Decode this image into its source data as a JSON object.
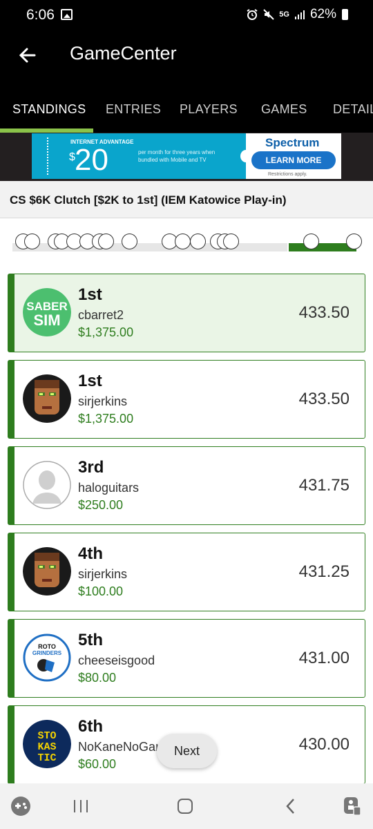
{
  "status": {
    "time": "6:06",
    "battery": "62%",
    "network": "5G"
  },
  "app": {
    "title": "GameCenter"
  },
  "tabs": [
    {
      "label": "STANDINGS",
      "active": true
    },
    {
      "label": "ENTRIES",
      "active": false
    },
    {
      "label": "PLAYERS",
      "active": false
    },
    {
      "label": "GAMES",
      "active": false
    },
    {
      "label": "DETAIL",
      "active": false
    }
  ],
  "ad": {
    "tagline": "INTERNET ADVANTAGE",
    "price": "20",
    "description": "per month for three years when bundled with Mobile and TV",
    "brand": "Spectrum",
    "cta": "LEARN MORE",
    "fine_print": "Restrictions apply."
  },
  "contest": {
    "title": "CS $6K Clutch [$2K to 1st] (IEM Katowice Play-in)"
  },
  "standings": [
    {
      "rank": "1st",
      "username": "cbarret2",
      "prize": "$1,375.00",
      "score": "433.50",
      "avatar": "sabersim-logo"
    },
    {
      "rank": "1st",
      "username": "sirjerkins",
      "prize": "$1,375.00",
      "score": "433.50",
      "avatar": "doom-face"
    },
    {
      "rank": "3rd",
      "username": "haloguitars",
      "prize": "$250.00",
      "score": "431.75",
      "avatar": "default-user"
    },
    {
      "rank": "4th",
      "username": "sirjerkins",
      "prize": "$100.00",
      "score": "431.25",
      "avatar": "doom-face"
    },
    {
      "rank": "5th",
      "username": "cheeseisgood",
      "prize": "$80.00",
      "score": "431.00",
      "avatar": "rotogrinders-logo"
    },
    {
      "rank": "6th",
      "username": "NoKaneNoGame",
      "prize": "$60.00",
      "score": "430.00",
      "avatar": "stokastic-logo"
    }
  ],
  "avatar_text": {
    "sabersim": [
      "SABER",
      "SIM"
    ],
    "rotogrinders": [
      "ROTO",
      "GRINDERS"
    ],
    "stokastic": [
      "STO",
      "KAS",
      "TIC"
    ]
  },
  "next_button": "Next",
  "colors": {
    "accent_green": "#2e7d1e",
    "tab_underline": "#8bc34a",
    "first_row_bg": "#eaf5e6"
  }
}
